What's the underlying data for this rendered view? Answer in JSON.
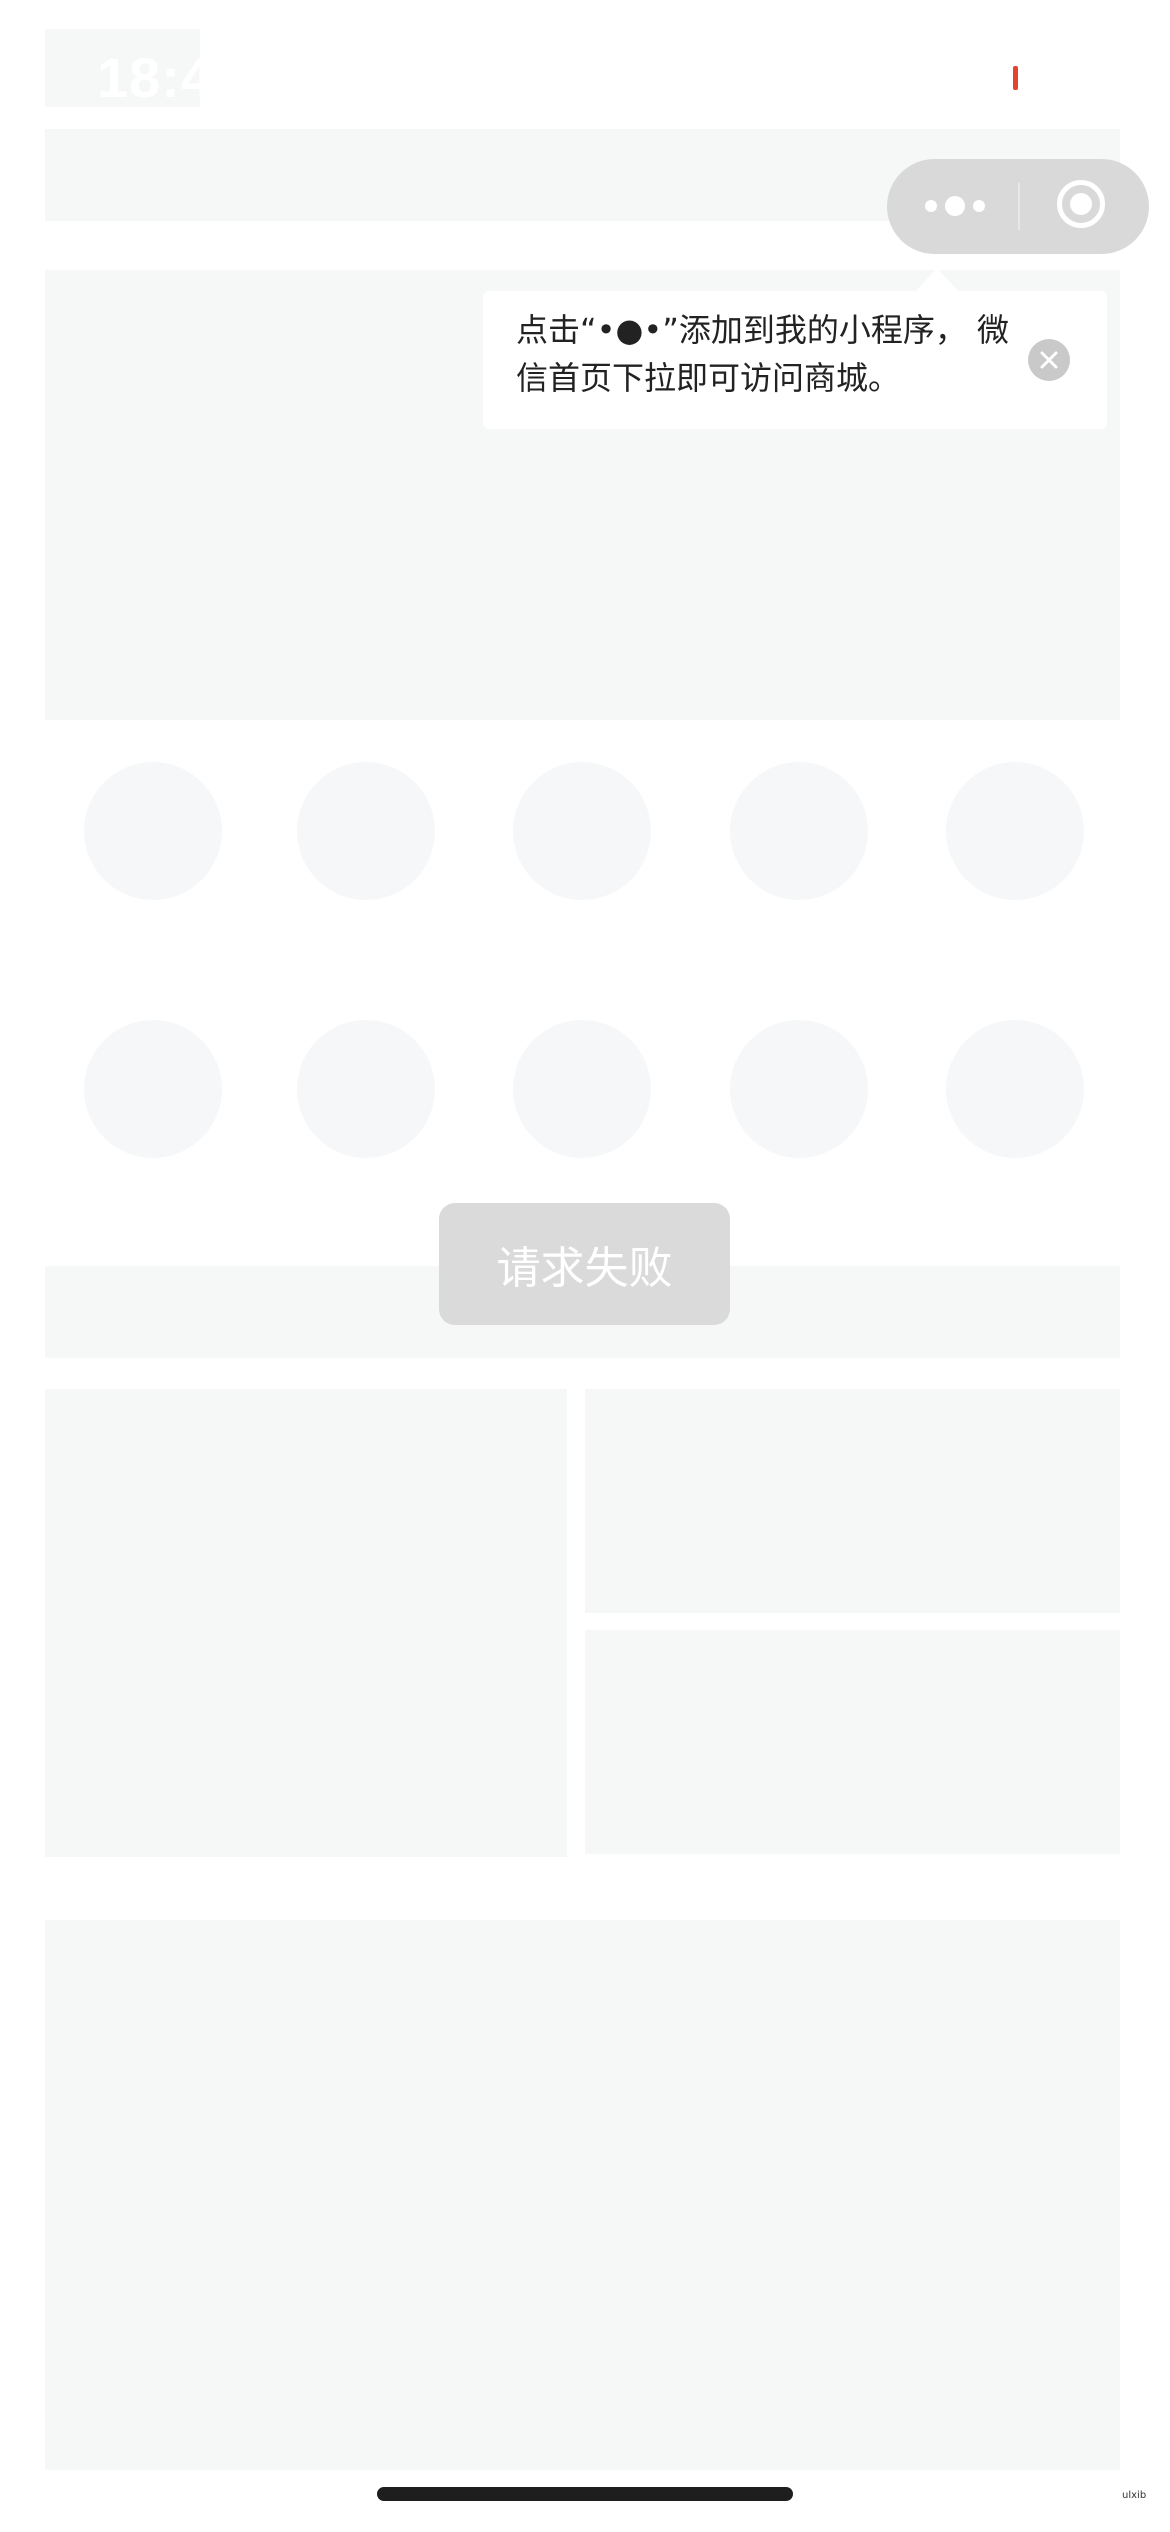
{
  "status_bar": {
    "time": "18:4"
  },
  "capsule": {
    "more_icon": "more-dots-icon",
    "close_icon": "target-circle-icon"
  },
  "tooltip": {
    "text": "点击“•●•”添加到我的小程序， 微信首页下拉即可访问商城。",
    "close_icon": "close-icon"
  },
  "toast": {
    "message": "请求失败"
  },
  "watermark": {
    "text": "ulxib"
  },
  "colors": {
    "skeleton": "#f6f7f7",
    "capsule": "#d9d9d9",
    "toast": "#dadada",
    "accent_red": "#e2452e"
  }
}
